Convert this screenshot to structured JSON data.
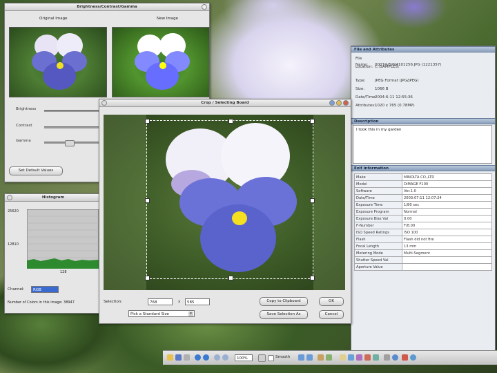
{
  "windows": {
    "bcg": {
      "title": "Brightness/Contrast/Gamma",
      "original_label": "Original Image",
      "new_label": "New Image",
      "sliders": [
        {
          "label": "Brightness",
          "level": 0.5
        },
        {
          "label": "Contrast",
          "level": 0.5
        },
        {
          "label": "Gamma",
          "level": 0.25
        }
      ],
      "default_button": "Set Default Values"
    },
    "histogram": {
      "title": "Histogram",
      "y_top": "25620",
      "y_mid": "12810",
      "x_mid": "128",
      "channel_label": "Channel:",
      "channel_value": "RGB",
      "footer": "Number of Colors in this image: 38947"
    },
    "crop": {
      "title": "Crop / Selecting Board",
      "selection_label": "Selection:",
      "width_value": "768",
      "x_label": "x",
      "height_value": "585",
      "ratio_value": "Pick a Standard Size",
      "buttons": {
        "copy_clipboard": "Copy to Clipboard",
        "ok": "OK",
        "save_selection": "Save Selection As",
        "cancel": "Cancel"
      }
    },
    "props": {
      "file_header": "File and Attributes",
      "file_rows": [
        {
          "k": "File Name:",
          "v": "00074-BVR4101256.JPG (1221357)"
        },
        {
          "k": "Location:",
          "v": "C:\\SAMPLES\\"
        }
      ],
      "attr_rows": [
        {
          "k": "Type:",
          "v": "JPEG Format (JPG/JPEG)"
        },
        {
          "k": "Size:",
          "v": "1066 B"
        },
        {
          "k": "Date/Time:",
          "v": "2004-6-11 12:55:36"
        },
        {
          "k": "Attributes:",
          "v": "1020 x 765 (0.78MP)"
        }
      ],
      "description_header": "Description",
      "description_text": "I took this in my garden",
      "exif_header": "Exif Information",
      "exif_rows": [
        {
          "k": "Make",
          "v": "MINOLTA CO.,LTD"
        },
        {
          "k": "Model",
          "v": "DiMAGE F100"
        },
        {
          "k": "Software",
          "v": "Ver.1.0"
        },
        {
          "k": "Date/Time",
          "v": "2003:07:11 12:07:24"
        },
        {
          "k": "Exposure Time",
          "v": "1/80 sec"
        },
        {
          "k": "Exposure Program",
          "v": "Normal"
        },
        {
          "k": "Exposure Bias Val",
          "v": "0.00"
        },
        {
          "k": "F-Number",
          "v": "F/8.00"
        },
        {
          "k": "ISO Speed Ratings",
          "v": "ISO 100"
        },
        {
          "k": "Flash",
          "v": "Flash did not fire"
        },
        {
          "k": "Focal Length",
          "v": "13 mm"
        },
        {
          "k": "Metering Mode",
          "v": "Multi-Segment"
        },
        {
          "k": "Shutter Speed Val",
          "v": ""
        },
        {
          "k": "Aperture Value",
          "v": ""
        }
      ]
    }
  },
  "taskbar": {
    "zoom": "100%",
    "mode_label": "Smooth"
  }
}
